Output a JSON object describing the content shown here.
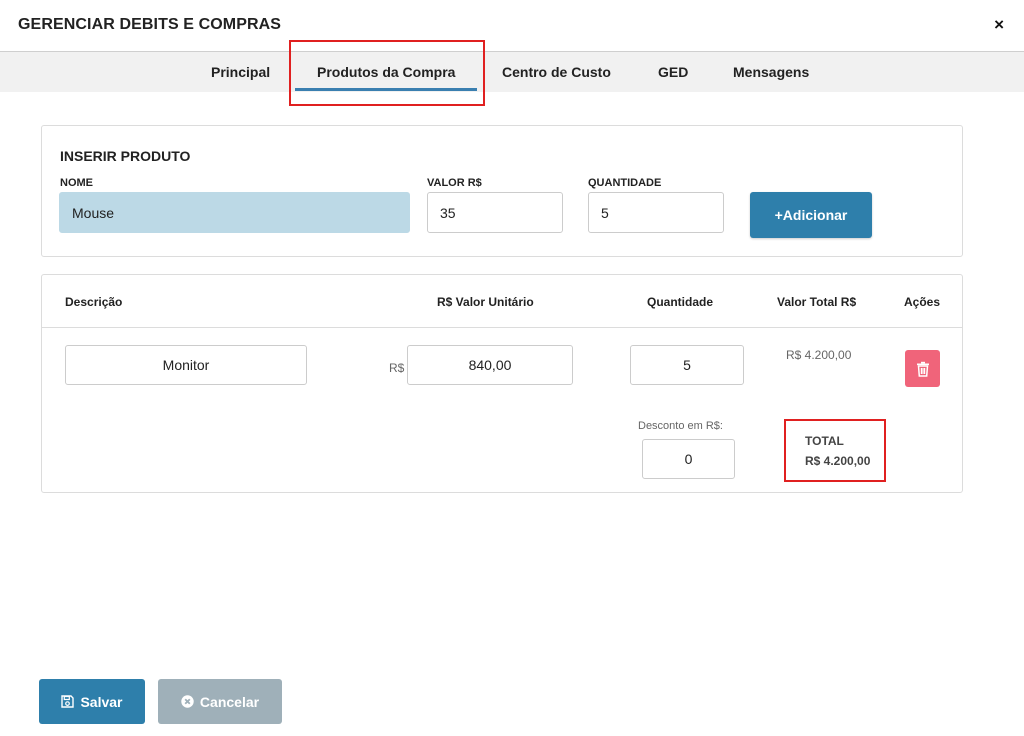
{
  "modal": {
    "title": "GERENCIAR DEBITS E COMPRAS",
    "close_symbol": "×"
  },
  "tabs": [
    {
      "label": "Principal",
      "active": false
    },
    {
      "label": "Produtos da Compra",
      "active": true
    },
    {
      "label": "Centro de Custo",
      "active": false
    },
    {
      "label": "GED",
      "active": false
    },
    {
      "label": "Mensagens",
      "active": false
    }
  ],
  "insert_product": {
    "section_title": "INSERIR PRODUTO",
    "name_label": "NOME",
    "name_value": "Mouse",
    "value_label": "VALOR R$",
    "value_value": "35",
    "qty_label": "QUANTIDADE",
    "qty_value": "5",
    "add_button": "+Adicionar"
  },
  "products_table": {
    "headers": [
      "Descrição",
      "R$ Valor Unitário",
      "Quantidade",
      "Valor Total R$",
      "Ações"
    ],
    "rows": [
      {
        "description": "Monitor",
        "currency_prefix": "R$",
        "unit_value": "840,00",
        "quantity": "5",
        "total": "R$ 4.200,00"
      }
    ],
    "discount_label": "Desconto em R$:",
    "discount_value": "0",
    "total_label": "TOTAL",
    "total_value": "R$ 4.200,00"
  },
  "footer": {
    "save_label": "Salvar",
    "cancel_label": "Cancelar"
  },
  "colors": {
    "primary": "#2e7fab",
    "danger": "#f0647a",
    "cancel": "#9fb0b9",
    "highlight": "#e02020",
    "name_field_bg": "#bcd9e6"
  },
  "icons": {
    "close": "close-icon",
    "delete": "trash-icon",
    "save": "floppy-disk-icon",
    "cancel": "times-circle-icon"
  }
}
